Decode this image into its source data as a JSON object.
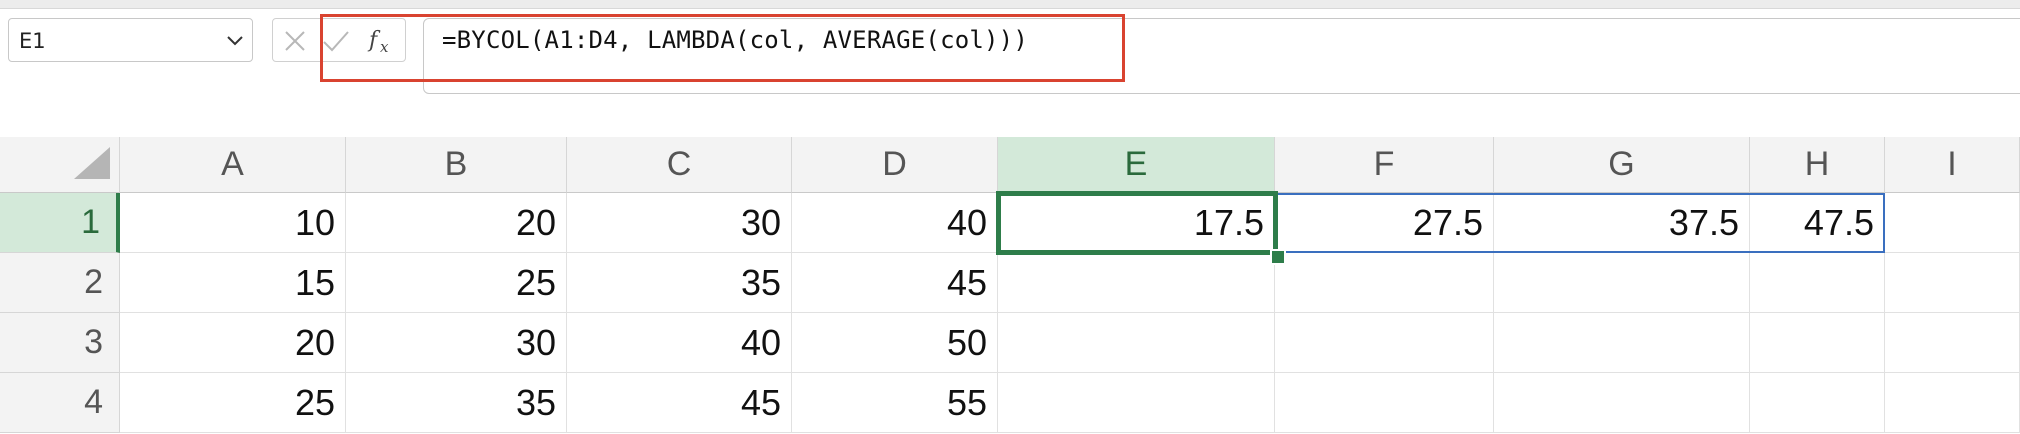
{
  "name_box": {
    "value": "E1"
  },
  "formula_bar": {
    "cancel_icon": "close-icon",
    "enter_icon": "checkmark-icon",
    "fx_icon": "fx-icon",
    "formula": "=BYCOL(A1:D4, LAMBDA(col, AVERAGE(col)))"
  },
  "colors": {
    "selection": "#2e7d4a",
    "spill_border": "#3a6fbf",
    "highlight": "#d94330",
    "header_active": "#d3e9d9"
  },
  "columns": [
    "A",
    "B",
    "C",
    "D",
    "E",
    "F",
    "G",
    "H",
    "I"
  ],
  "rows": [
    "1",
    "2",
    "3",
    "4"
  ],
  "cells": [
    [
      "10",
      "20",
      "30",
      "40",
      "17.5",
      "27.5",
      "37.5",
      "47.5",
      ""
    ],
    [
      "15",
      "25",
      "35",
      "45",
      "",
      "",
      "",
      "",
      ""
    ],
    [
      "20",
      "30",
      "40",
      "50",
      "",
      "",
      "",
      "",
      ""
    ],
    [
      "25",
      "35",
      "45",
      "55",
      "",
      "",
      "",
      "",
      ""
    ]
  ],
  "active_cell": "E1"
}
